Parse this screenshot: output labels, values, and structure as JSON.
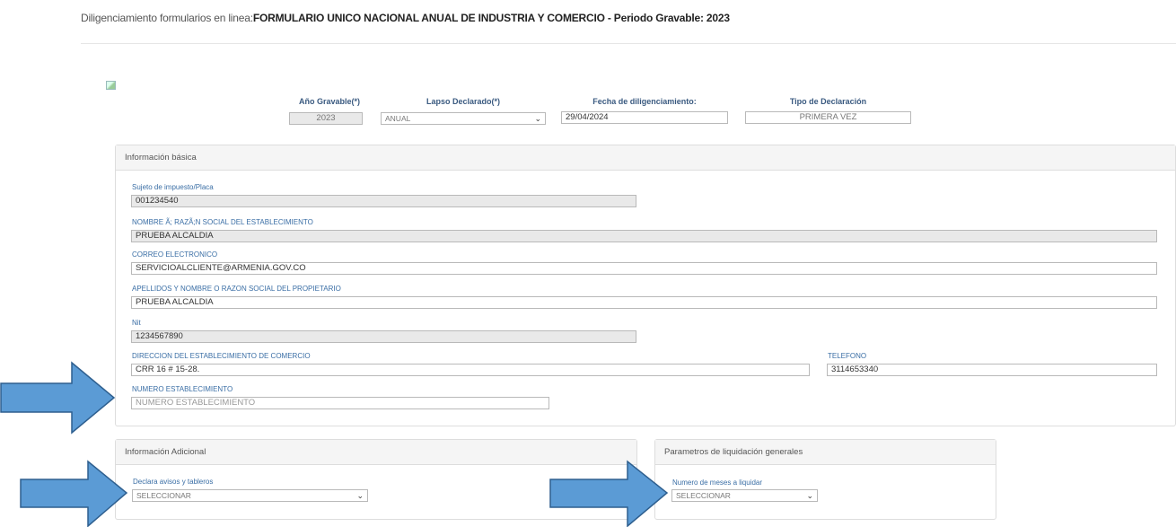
{
  "header": {
    "prefix": "Diligenciamiento formularios en linea:",
    "title": "FORMULARIO UNICO NACIONAL ANUAL DE INDUSTRIA Y COMERCIO - Periodo Gravable: 2023"
  },
  "top": {
    "year_label": "Año Gravable(*)",
    "year_value": "2023",
    "lapse_label": "Lapso Declarado(*)",
    "lapse_value": "ANUAL",
    "date_label": "Fecha de diligenciamiento:",
    "date_value": "29/04/2024",
    "type_label": "Tipo de Declaración",
    "type_value": "PRIMERA VEZ"
  },
  "basic": {
    "title": "Información básica",
    "subject_label": "Sujeto de impuesto/Placa",
    "subject_value": "001234540",
    "name_label": "NOMBRE Ã; RAZÃ;N SOCIAL DEL ESTABLECIMIENTO",
    "name_value": "PRUEBA ALCALDIA",
    "email_label": "CORREO ELECTRONICO",
    "email_value": "SERVICIOALCLIENTE@ARMENIA.GOV.CO",
    "owner_label": "APELLIDOS Y NOMBRE O RAZON SOCIAL DEL PROPIETARIO",
    "owner_value": "PRUEBA ALCALDIA",
    "nit_label": "Nit",
    "nit_value": "1234567890",
    "address_label": "DIRECCION DEL ESTABLECIMIENTO DE COMERCIO",
    "address_value": "CRR 16 # 15-28.",
    "phone_label": "TELEFONO",
    "phone_value": "3114653340",
    "estab_label": "NUMERO ESTABLECIMIENTO",
    "estab_placeholder": "NUMERO ESTABLECIMIENTO"
  },
  "additional": {
    "title": "Información Adicional",
    "ads_label": "Declara avisos y tableros",
    "ads_value": "SELECCIONAR"
  },
  "params": {
    "title": "Parametros de liquidación generales",
    "months_label": "Numero de meses a liquidar",
    "months_value": "SELECCIONAR"
  },
  "colors": {
    "arrow_fill": "#5b9bd5",
    "arrow_stroke": "#2e5f8f",
    "label_blue": "#3a6ea5"
  }
}
